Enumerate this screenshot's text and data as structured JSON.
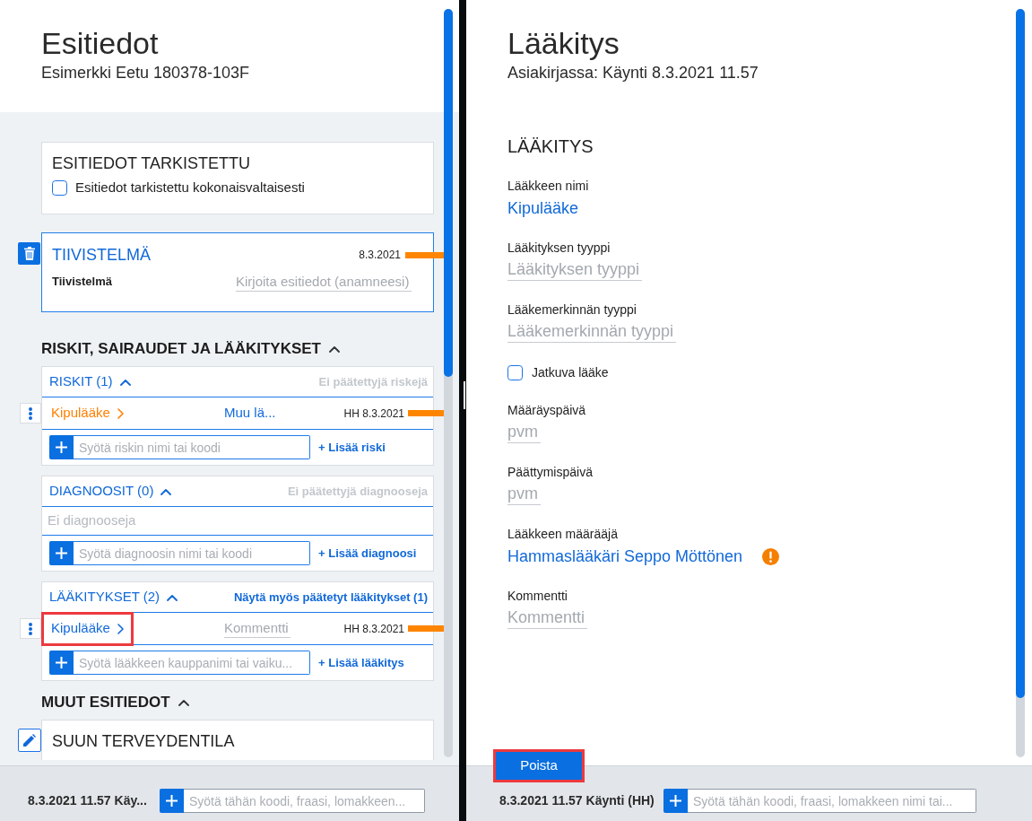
{
  "left_panel": {
    "title": "Esitiedot",
    "subtitle": "Esimerkki Eetu 180378-103F",
    "review_card": {
      "heading": "ESITIEDOT TARKISTETTU",
      "checkbox": {
        "label": "Esitiedot tarkistettu kokonaisvaltaisesti",
        "checked": false
      }
    },
    "summary_card": {
      "heading": "TIIVISTELMÄ",
      "date": "8.3.2021",
      "field_label": "Tiivistelmä",
      "placeholder": "Kirjoita esitiedot (anamneesi)"
    },
    "sections": [
      {
        "heading": "RISKIT, SAIRAUDET JA LÄÄKITYKSET",
        "expanded": true,
        "groups": [
          {
            "kind": "risk",
            "title": "RISKIT (1)",
            "expanded": true,
            "side_link": {
              "label": "Ei päätettyjä riskejä",
              "disabled": true
            },
            "items": [
              {
                "name": "Kipulääke",
                "detail": "Muu lä...",
                "date": "HH 8.3.2021",
                "highlighted": false
              }
            ],
            "add_placeholder": "Syötä riskin nimi tai koodi",
            "add_link": "+ Lisää riski"
          },
          {
            "kind": "diagnosis",
            "title": "DIAGNOOSIT (0)",
            "expanded": true,
            "side_link": {
              "label": "Ei päätettyjä diagnooseja",
              "disabled": true
            },
            "empty_text": "Ei diagnooseja",
            "add_placeholder": "Syötä diagnoosin nimi tai koodi",
            "add_link": "+ Lisää diagnoosi"
          },
          {
            "kind": "medication",
            "title": "LÄÄKITYKSET (2)",
            "expanded": true,
            "side_link": {
              "label": "Näytä myös päätetyt lääkitykset (1)",
              "disabled": false
            },
            "items": [
              {
                "name": "Kipulääke",
                "comment_placeholder": "Kommentti",
                "date": "HH 8.3.2021",
                "highlighted": true
              }
            ],
            "add_placeholder": "Syötä lääkkeen kauppanimi tai vaiku...",
            "add_link": "+ Lisää lääkitys"
          }
        ]
      },
      {
        "heading": "MUUT ESITIEDOT",
        "expanded": true,
        "cards": [
          {
            "heading": "SUUN TERVEYDENTILA"
          }
        ]
      }
    ],
    "footer": {
      "visit": "8.3.2021 11.57 Käy...",
      "placeholder": "Syötä tähän koodi, fraasi, lomakkeen..."
    }
  },
  "right_panel": {
    "title": "Lääkitys",
    "subtitle": "Asiakirjassa: Käynti 8.3.2021 11.57",
    "section_heading": "LÄÄKITYS",
    "fields": [
      {
        "kind": "link",
        "label": "Lääkkeen nimi",
        "value": "Kipulääke",
        "warning": false
      },
      {
        "kind": "input",
        "label": "Lääkityksen tyyppi",
        "placeholder": "Lääkityksen tyyppi"
      },
      {
        "kind": "input",
        "label": "Lääkemerkinnän tyyppi",
        "placeholder": "Lääkemerkinnän tyyppi"
      },
      {
        "kind": "checkbox",
        "label": "Jatkuva lääke",
        "checked": false
      },
      {
        "kind": "input",
        "label": "Määräyspäivä",
        "placeholder": "pvm"
      },
      {
        "kind": "input",
        "label": "Päättymispäivä",
        "placeholder": "pvm"
      },
      {
        "kind": "link",
        "label": "Lääkkeen määrääjä",
        "value": "Hammaslääkäri Seppo Möttönen",
        "warning": true
      },
      {
        "kind": "input",
        "label": "Kommentti",
        "placeholder": "Kommentti"
      }
    ],
    "delete_button": {
      "label": "Poista",
      "highlighted": true
    },
    "footer": {
      "visit": "8.3.2021 11.57 Käynti (HH)",
      "placeholder": "Syötä tähän koodi, fraasi, lomakkeen nimi tai..."
    }
  }
}
